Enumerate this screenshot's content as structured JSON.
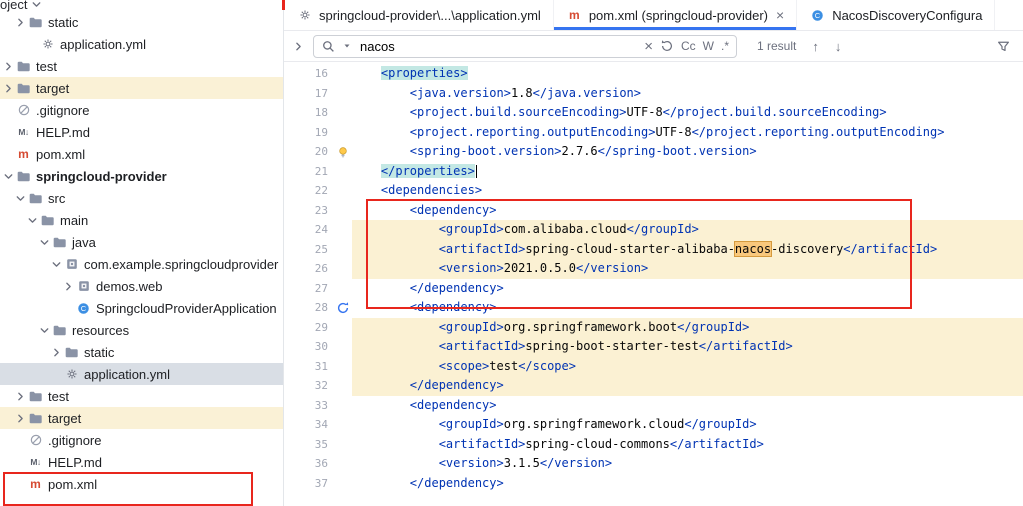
{
  "colors": {
    "accent": "#3574F0",
    "annotation_red": "#E8261D",
    "changed_line_bg": "#FBF1D3",
    "search_match_bg": "#F9C87C",
    "tag_match_bg": "#C3E8E4",
    "selected_row_bg": "#D9DEE5",
    "excluded_row_bg": "#FAF1D6",
    "xml_tag_color": "#0033B3"
  },
  "project_panel": {
    "header_label": "oject",
    "items": [
      {
        "label": "static",
        "icon": "folder",
        "depth": 2,
        "chevron": "right"
      },
      {
        "label": "application.yml",
        "icon": "yaml",
        "depth": 3
      },
      {
        "label": "test",
        "icon": "folder",
        "depth": 1,
        "chevron": "right"
      },
      {
        "label": "target",
        "icon": "folder",
        "depth": 1,
        "chevron": "right",
        "bg": "cream"
      },
      {
        "label": ".gitignore",
        "icon": "ignore",
        "depth": 1
      },
      {
        "label": "HELP.md",
        "icon": "markdown",
        "depth": 1
      },
      {
        "label": "pom.xml",
        "icon": "maven",
        "depth": 1
      },
      {
        "label": "springcloud-provider",
        "icon": "folder",
        "depth": 1,
        "chevron": "down",
        "bold": true
      },
      {
        "label": "src",
        "icon": "folder",
        "depth": 2,
        "chevron": "down"
      },
      {
        "label": "main",
        "icon": "folder",
        "depth": 3,
        "chevron": "down"
      },
      {
        "label": "java",
        "icon": "folder",
        "depth": 4,
        "chevron": "down"
      },
      {
        "label": "com.example.springcloudprovider",
        "icon": "package",
        "depth": 5,
        "chevron": "down"
      },
      {
        "label": "demos.web",
        "icon": "package",
        "depth": 6,
        "chevron": "right"
      },
      {
        "label": "SpringcloudProviderApplication",
        "icon": "class",
        "depth": 6
      },
      {
        "label": "resources",
        "icon": "folder",
        "depth": 4,
        "chevron": "down"
      },
      {
        "label": "static",
        "icon": "folder",
        "depth": 5,
        "chevron": "right"
      },
      {
        "label": "application.yml",
        "icon": "yaml",
        "depth": 5,
        "selected": true
      },
      {
        "label": "test",
        "icon": "folder",
        "depth": 2,
        "chevron": "right"
      },
      {
        "label": "target",
        "icon": "folder",
        "depth": 2,
        "chevron": "right",
        "bg": "cream"
      },
      {
        "label": ".gitignore",
        "icon": "ignore",
        "depth": 2
      },
      {
        "label": "HELP.md",
        "icon": "markdown",
        "depth": 2
      },
      {
        "label": "pom.xml",
        "icon": "maven",
        "depth": 2
      }
    ]
  },
  "tabs": [
    {
      "label": "springcloud-provider\\...\\application.yml",
      "icon": "yaml",
      "active": false
    },
    {
      "label": "pom.xml (springcloud-provider)",
      "icon": "maven",
      "active": true,
      "closable": true
    },
    {
      "label": "NacosDiscoveryConfigura",
      "icon": "class",
      "active": false
    }
  ],
  "search": {
    "value": "nacos",
    "results_label": "1 result",
    "match_case_label": "Cc",
    "words_label": "W",
    "regex_label": ".*"
  },
  "editor": {
    "lines": [
      {
        "n": 16,
        "text": "    <properties>",
        "tag_hl": true
      },
      {
        "n": 17,
        "text": "        <java.version>1.8</java.version>"
      },
      {
        "n": 18,
        "text": "        <project.build.sourceEncoding>UTF-8</project.build.sourceEncoding>"
      },
      {
        "n": 19,
        "text": "        <project.reporting.outputEncoding>UTF-8</project.reporting.outputEncoding>"
      },
      {
        "n": 20,
        "text": "        <spring-boot.version>2.7.6</spring-boot.version>",
        "gutter": "bulb"
      },
      {
        "n": 21,
        "text": "    </properties>",
        "tag_hl": true,
        "caret": true
      },
      {
        "n": 22,
        "text": "    <dependencies>"
      },
      {
        "n": 23,
        "text": "        <dependency>"
      },
      {
        "n": 24,
        "text": "            <groupId>com.alibaba.cloud</groupId>",
        "changed": true
      },
      {
        "n": 25,
        "text": "            <artifactId>spring-cloud-starter-alibaba-nacos-discovery</artifactId>",
        "changed": true
      },
      {
        "n": 26,
        "text": "            <version>2021.0.5.0</version>",
        "changed": true
      },
      {
        "n": 27,
        "text": "        </dependency>"
      },
      {
        "n": 28,
        "text": "        <dependency>",
        "gutter": "refresh"
      },
      {
        "n": 29,
        "text": "            <groupId>org.springframework.boot</groupId>",
        "changed": true
      },
      {
        "n": 30,
        "text": "            <artifactId>spring-boot-starter-test</artifactId>",
        "changed": true
      },
      {
        "n": 31,
        "text": "            <scope>test</scope>",
        "changed": true
      },
      {
        "n": 32,
        "text": "        </dependency>",
        "changed": true
      },
      {
        "n": 33,
        "text": "        <dependency>"
      },
      {
        "n": 34,
        "text": "            <groupId>org.springframework.cloud</groupId>"
      },
      {
        "n": 35,
        "text": "            <artifactId>spring-cloud-commons</artifactId>"
      },
      {
        "n": 36,
        "text": "            <version>3.1.5</version>"
      },
      {
        "n": 37,
        "text": "        </dependency>"
      }
    ]
  },
  "annotations": [
    {
      "target": "dependency-block-lines-23-27",
      "color": "#E8261D"
    },
    {
      "target": "pom-xml-tree-item",
      "color": "#E8261D"
    }
  ]
}
